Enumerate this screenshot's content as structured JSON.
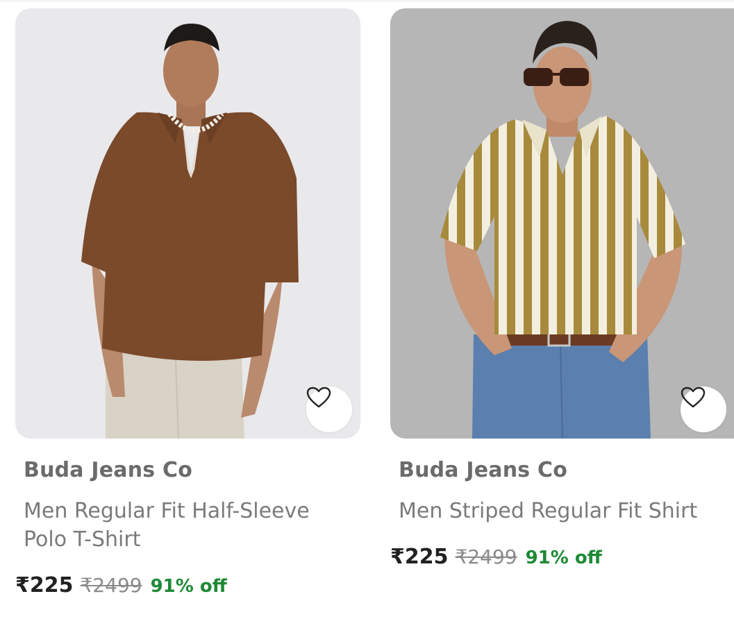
{
  "products": [
    {
      "brand": "Buda Jeans Co",
      "title": "Men Regular Fit Half-Sleeve Polo T-Shirt",
      "price": "₹225",
      "mrp": "₹2499",
      "discount": "91% off",
      "wishlist_icon": "heart-outline-icon"
    },
    {
      "brand": "Buda Jeans Co",
      "title": "Men Striped Regular Fit Shirt",
      "price": "₹225",
      "mrp": "₹2499",
      "discount": "91% off",
      "wishlist_icon": "heart-outline-icon"
    }
  ],
  "colors": {
    "discount": "#1e8a36",
    "brand_text": "#6b6b6b",
    "price_text": "#212121"
  }
}
